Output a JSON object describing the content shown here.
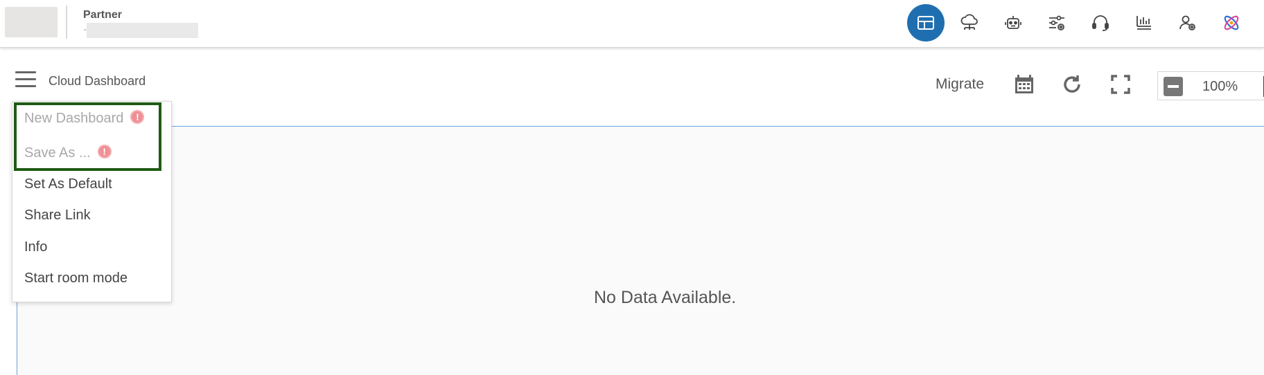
{
  "header": {
    "brand_title": "Partner",
    "brand_sub_mark": "-",
    "nav_icons": [
      {
        "name": "dashboard-layout-icon",
        "active": true
      },
      {
        "name": "cloud-network-icon",
        "active": false
      },
      {
        "name": "robot-icon",
        "active": false
      },
      {
        "name": "settings-sliders-icon",
        "active": false
      },
      {
        "name": "headset-icon",
        "active": false
      },
      {
        "name": "report-chart-icon",
        "active": false
      },
      {
        "name": "user-settings-icon",
        "active": false
      },
      {
        "name": "ai-atom-logo-icon",
        "active": false
      }
    ],
    "active_color": "#1f6fb0"
  },
  "toolbar": {
    "title": "Cloud Dashboard",
    "migrate_label": "Migrate",
    "icons": [
      "calendar-icon",
      "refresh-icon",
      "fullscreen-icon"
    ],
    "zoom_value": "100%"
  },
  "menu": {
    "items": [
      {
        "label": "New Dashboard",
        "disabled": true,
        "badge": "!"
      },
      {
        "label": "Save As ...",
        "disabled": true,
        "badge": "!"
      },
      {
        "label": "Set As Default",
        "disabled": false
      },
      {
        "label": "Share Link",
        "disabled": false
      },
      {
        "label": "Info",
        "disabled": false
      },
      {
        "label": "Start room mode",
        "disabled": false
      }
    ],
    "highlight_color": "#1f5a14",
    "badge_color": "#ef8f94"
  },
  "canvas": {
    "empty_message": "No Data Available."
  }
}
